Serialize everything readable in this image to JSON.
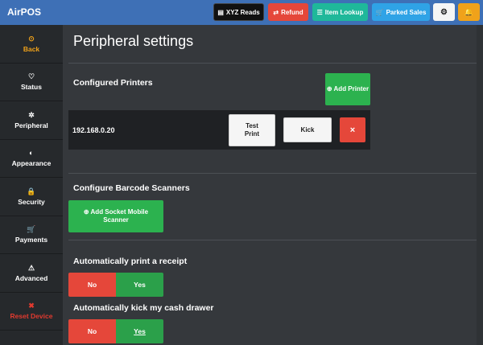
{
  "app": {
    "title": "AirPOS"
  },
  "toolbar": {
    "xyz_reads": "XYZ Reads",
    "refund": "Refund",
    "item_lookup": "Item Lookup",
    "parked_sales": "Parked Sales",
    "settings_icon": "gear-icon",
    "notifications_icon": "bell-icon"
  },
  "sidebar": {
    "items": [
      {
        "label": "Back",
        "icon": "back-circle-icon"
      },
      {
        "label": "Status",
        "icon": "heartbeat-icon"
      },
      {
        "label": "Peripheral",
        "icon": "cog-icon"
      },
      {
        "label": "Appearance",
        "icon": "contrast-icon"
      },
      {
        "label": "Security",
        "icon": "lock-icon"
      },
      {
        "label": "Payments",
        "icon": "cart-icon"
      },
      {
        "label": "Advanced",
        "icon": "warning-icon"
      },
      {
        "label": "Reset Device",
        "icon": "x-icon"
      }
    ]
  },
  "main": {
    "title": "Peripheral settings",
    "printers": {
      "heading": "Configured Printers",
      "add_button": "Add Printer",
      "items": [
        {
          "address": "192.168.0.20",
          "test_label": "Test Print",
          "kick_label": "Kick",
          "remove_label": "×"
        }
      ]
    },
    "scanners": {
      "heading": "Configure Barcode Scanners",
      "add_button": "Add Socket Mobile Scanner"
    },
    "auto_print": {
      "heading": "Automatically print a receipt",
      "no": "No",
      "yes": "Yes"
    },
    "auto_kick": {
      "heading": "Automatically kick my cash drawer",
      "no": "No",
      "yes": "Yes"
    }
  },
  "colors": {
    "topbar": "#3e70b6",
    "accent_orange": "#f0a21a",
    "green": "#2cb24f",
    "red": "#e5473a",
    "teal": "#1fb89a",
    "light_blue": "#2fa3e6"
  }
}
